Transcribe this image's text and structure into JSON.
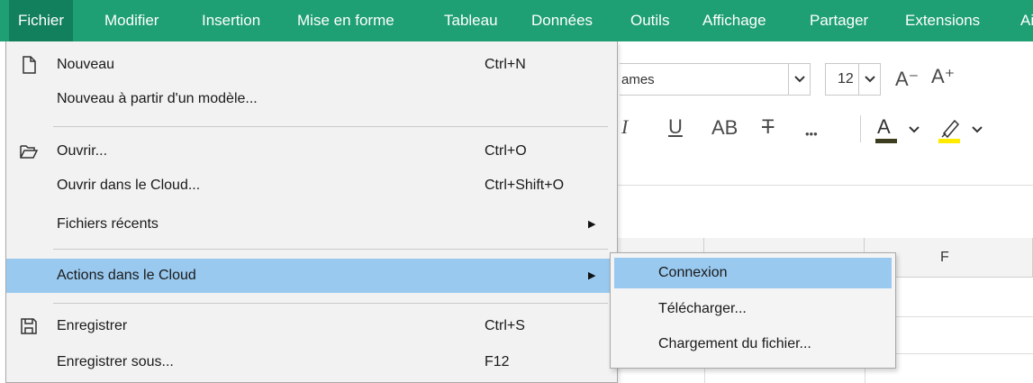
{
  "menubar": {
    "items": [
      {
        "label": "Fichier"
      },
      {
        "label": "Modifier"
      },
      {
        "label": "Insertion"
      },
      {
        "label": "Mise en forme"
      },
      {
        "label": "Tableau"
      },
      {
        "label": "Données"
      },
      {
        "label": "Outils"
      },
      {
        "label": "Affichage"
      },
      {
        "label": "Partager"
      },
      {
        "label": "Extensions"
      },
      {
        "label": "Ai"
      }
    ],
    "active": "Fichier",
    "color": "#1e9f74"
  },
  "toolbar": {
    "font_name": "ames",
    "font_size": "12",
    "grow_font": "A⁻",
    "shrink_font": "A⁺",
    "italic": "I",
    "underline": "U",
    "caps": "AB",
    "strike": "T",
    "more": "•••",
    "text_color_icon": "text-color-icon",
    "highlight_icon": "highlight-icon",
    "text_color": "#3c3c1e",
    "highlight_color": "#ffeb00"
  },
  "sheet": {
    "column_f": "F"
  },
  "file_menu": {
    "items": [
      {
        "label": "Nouveau",
        "shortcut": "Ctrl+N",
        "icon": "new-file-icon"
      },
      {
        "label": "Nouveau à partir d'un modèle...",
        "shortcut": ""
      },
      {
        "label": "Ouvrir...",
        "shortcut": "Ctrl+O",
        "icon": "folder-open-icon"
      },
      {
        "label": "Ouvrir dans le Cloud...",
        "shortcut": "Ctrl+Shift+O"
      },
      {
        "label": "Fichiers récents",
        "shortcut": "",
        "submenu": true
      },
      {
        "label": "Actions dans le Cloud",
        "shortcut": "",
        "submenu": true,
        "highlighted": true
      },
      {
        "label": "Enregistrer",
        "shortcut": "Ctrl+S",
        "icon": "save-icon"
      },
      {
        "label": "Enregistrer sous...",
        "shortcut": "F12"
      }
    ]
  },
  "cloud_submenu": {
    "items": [
      {
        "label": "Connexion",
        "highlighted": true
      },
      {
        "label": "Télécharger..."
      },
      {
        "label": "Chargement du fichier..."
      }
    ]
  },
  "highlight_color": "#99c9ef"
}
